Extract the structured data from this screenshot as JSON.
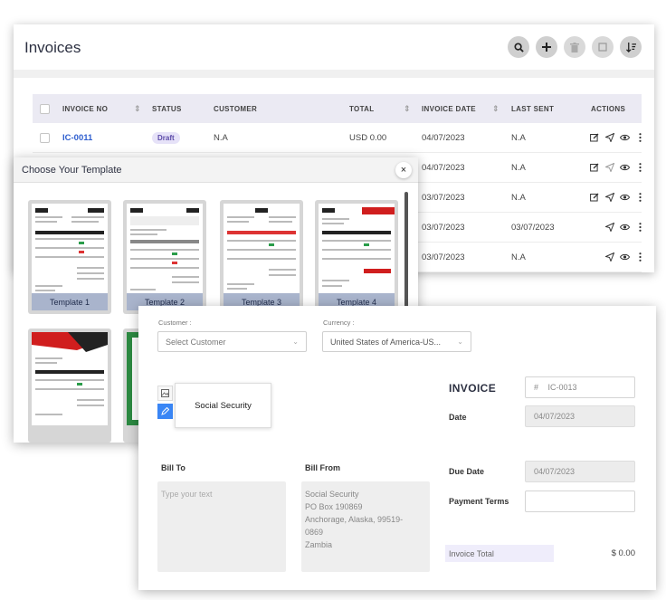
{
  "invoices": {
    "title": "Invoices",
    "columns": [
      "INVOICE NO",
      "STATUS",
      "CUSTOMER",
      "TOTAL",
      "INVOICE DATE",
      "LAST SENT",
      "ACTIONS"
    ],
    "rows": [
      {
        "invoice_no": "IC-0011",
        "status": "Draft",
        "customer": "N.A",
        "total": "USD 0.00",
        "invoice_date": "04/07/2023",
        "last_sent": "N.A"
      },
      {
        "invoice_no": "",
        "status": "",
        "customer": "",
        "total": "",
        "invoice_date": "04/07/2023",
        "last_sent": "N.A"
      },
      {
        "invoice_no": "",
        "status": "",
        "customer": "",
        "total": "",
        "invoice_date": "03/07/2023",
        "last_sent": "N.A"
      },
      {
        "invoice_no": "",
        "status": "",
        "customer": "",
        "total": "",
        "invoice_date": "03/07/2023",
        "last_sent": "03/07/2023"
      },
      {
        "invoice_no": "",
        "status": "",
        "customer": "",
        "total": "",
        "invoice_date": "03/07/2023",
        "last_sent": "N.A"
      }
    ]
  },
  "template_modal": {
    "title": "Choose Your Template",
    "close": "×",
    "templates": [
      "Template 1",
      "Template 2",
      "Template 3",
      "Template 4"
    ]
  },
  "invoice_form": {
    "customer_label": "Customer :",
    "customer_placeholder": "Select Customer",
    "currency_label": "Currency :",
    "currency_value": "United States of America-US...",
    "company_name": "Social Security",
    "heading": "INVOICE",
    "number_prefix": "#",
    "number_value": "IC-0013",
    "date_label": "Date",
    "date_value": "04/07/2023",
    "due_date_label": "Due Date",
    "due_date_value": "04/07/2023",
    "payment_terms_label": "Payment Terms",
    "bill_to_label": "Bill To",
    "bill_to_placeholder": "Type your text",
    "bill_from_label": "Bill From",
    "bill_from_lines": [
      "Social Security",
      "PO Box 190869",
      "Anchorage, Alaska, 99519-",
      "0869",
      "Zambia"
    ],
    "invoice_total_label": "Invoice Total",
    "invoice_total_value": "$ 0.00"
  },
  "colors": {
    "accent": "#2f5fcf",
    "header_bg": "#ebeaf3",
    "label_bg": "#a9b4cc",
    "edit_blue": "#3a86f5"
  }
}
